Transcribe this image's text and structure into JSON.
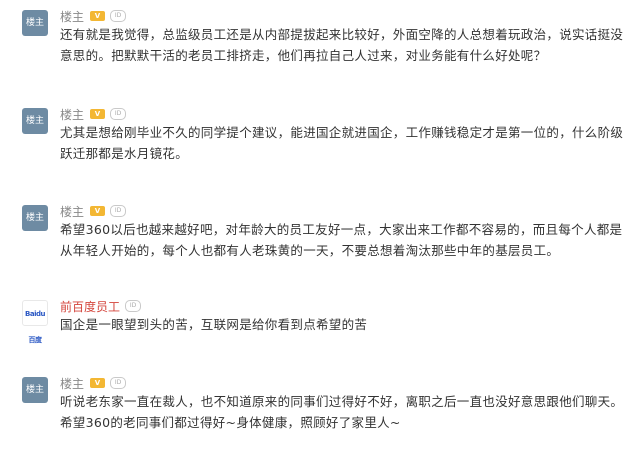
{
  "comments": [
    {
      "author": "楼主",
      "text": "还有就是我觉得，总监级员工还是从内部提拔起来比较好，外面空降的人总想着玩政治，说实话挺没意思的。把默默干活的老员工排挤走，他们再拉自己人过来，对业务能有什么好处呢？"
    },
    {
      "author": "楼主",
      "text": "尤其是想给刚毕业不久的同学提个建议，能进国企就进国企，工作赚钱稳定才是第一位的，什么阶级跃迁那都是水月镜花。"
    },
    {
      "author": "楼主",
      "text": "希望360以后也越来越好吧，对年龄大的员工友好一点，大家出来工作都不容易的，而且每个人都是从年轻人开始的，每个人也都有人老珠黄的一天，不要总想着淘汰那些中年的基层员工。"
    },
    {
      "author": "前百度员工",
      "avatar_text": "Baidu百度",
      "text": "国企是一眼望到头的苦，互联网是给你看到点希望的苦"
    },
    {
      "author": "楼主",
      "text": "听说老东家一直在裁人，也不知道原来的同事们过得好不好，离职之后一直也没好意思跟他们聊天。希望360的老同事们都过得好~身体健康，照顾好了家里人~"
    }
  ],
  "badges": {
    "v": "V",
    "id": "ID"
  },
  "colors": {
    "author_default": "#888888",
    "author_highlight": "#d4453c",
    "badge_v": "#f3b733"
  }
}
